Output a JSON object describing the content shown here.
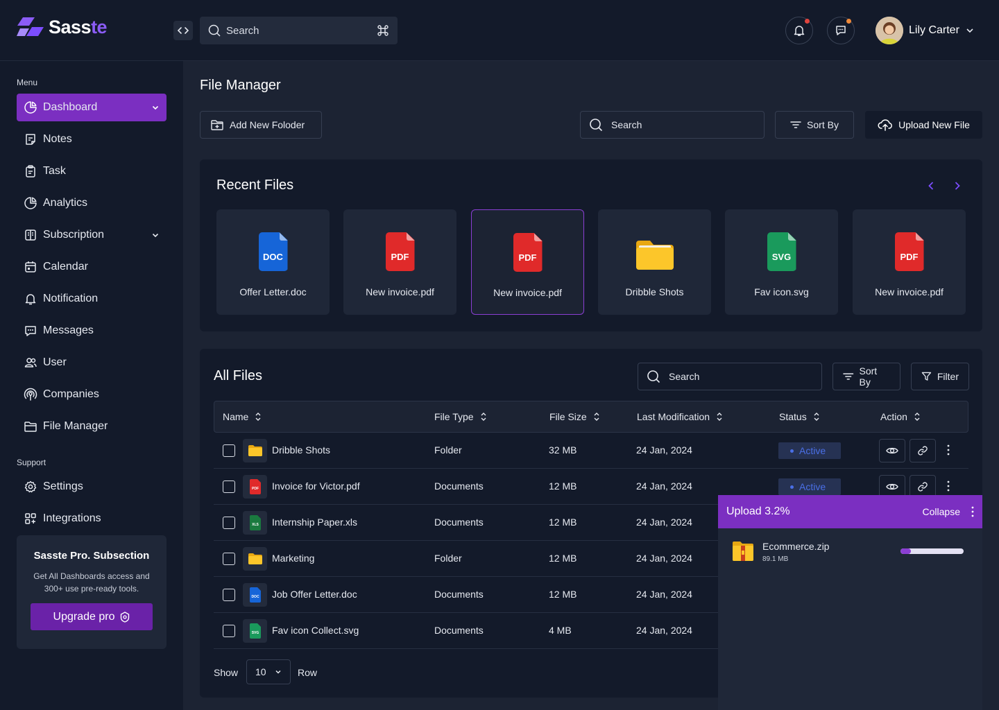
{
  "brand": {
    "name_main": "Sass",
    "name_accent": "te"
  },
  "topbar": {
    "search_placeholder": "Search",
    "user_name": "Lily Carter",
    "notification_dot_color": "#e0443e",
    "message_dot_color": "#f08a3a"
  },
  "sidebar": {
    "menu_label": "Menu",
    "support_label": "Support",
    "menu_items": [
      {
        "label": "Dashboard",
        "icon": "pie-chart-icon",
        "active": true,
        "expandable": true
      },
      {
        "label": "Notes",
        "icon": "note-icon"
      },
      {
        "label": "Task",
        "icon": "clipboard-icon"
      },
      {
        "label": "Analytics",
        "icon": "analytics-icon"
      },
      {
        "label": "Subscription",
        "icon": "subscription-icon",
        "expandable": true
      },
      {
        "label": "Calendar",
        "icon": "calendar-icon"
      },
      {
        "label": "Notification",
        "icon": "bell-icon"
      },
      {
        "label": "Messages",
        "icon": "message-icon"
      },
      {
        "label": "User",
        "icon": "users-icon"
      },
      {
        "label": "Companies",
        "icon": "companies-icon"
      },
      {
        "label": "File Manager",
        "icon": "folder-icon"
      }
    ],
    "support_items": [
      {
        "label": "Settings",
        "icon": "gear-icon"
      },
      {
        "label": "Integrations",
        "icon": "integrations-icon"
      }
    ],
    "promo": {
      "title": "Sasste Pro. Subsection",
      "description": "Get All Dashboards access and 300+ use pre-ready tools.",
      "button": "Upgrade pro"
    }
  },
  "page": {
    "title": "File Manager",
    "add_folder": "Add New Foloder",
    "search_placeholder": "Search",
    "sort_by": "Sort By",
    "upload": "Upload New File"
  },
  "recent": {
    "title": "Recent Files",
    "files": [
      {
        "name": "Offer Letter.doc",
        "kind": "DOC",
        "color": "#1665d8"
      },
      {
        "name": "New invoice.pdf",
        "kind": "PDF",
        "color": "#e02a2a"
      },
      {
        "name": "New invoice.pdf",
        "kind": "PDF",
        "color": "#e02a2a",
        "selected": true
      },
      {
        "name": "Dribble Shots",
        "kind": "FOLDER",
        "color": "#f7c21b"
      },
      {
        "name": "Fav icon.svg",
        "kind": "SVG",
        "color": "#1a9a5c"
      },
      {
        "name": "New invoice.pdf",
        "kind": "PDF",
        "color": "#e02a2a"
      }
    ]
  },
  "all_files": {
    "title": "All Files",
    "search_placeholder": "Search",
    "sort_by": "Sort By",
    "filter": "Filter",
    "columns": [
      "Name",
      "File Type",
      "File Size",
      "Last Modification",
      "Status",
      "Action"
    ],
    "rows": [
      {
        "name": "Dribble Shots",
        "kind": "FOLDER",
        "type": "Folder",
        "size": "32 MB",
        "modified": "24 Jan, 2024",
        "status": "Active"
      },
      {
        "name": "Invoice for Victor.pdf",
        "kind": "PDF",
        "type": "Documents",
        "size": "12 MB",
        "modified": "24 Jan, 2024",
        "status": "Active"
      },
      {
        "name": "Internship Paper.xls",
        "kind": "XLS",
        "type": "Documents",
        "size": "12 MB",
        "modified": "24 Jan, 2024",
        "status": ""
      },
      {
        "name": "Marketing",
        "kind": "FOLDER",
        "type": "Folder",
        "size": "12 MB",
        "modified": "24 Jan, 2024",
        "status": ""
      },
      {
        "name": "Job Offer Letter.doc",
        "kind": "DOC",
        "type": "Documents",
        "size": "12 MB",
        "modified": "24 Jan, 2024",
        "status": ""
      },
      {
        "name": "Fav icon Collect.svg",
        "kind": "SVG",
        "type": "Documents",
        "size": "4 MB",
        "modified": "24 Jan, 2024",
        "status": ""
      }
    ],
    "show_label": "Show",
    "rows_value": "10",
    "row_label": "Row"
  },
  "upload_panel": {
    "title": "Upload 3.2%",
    "collapse": "Collapse",
    "file_name": "Ecommerce.zip",
    "file_size": "89.1 MB",
    "progress_percent": 17
  }
}
